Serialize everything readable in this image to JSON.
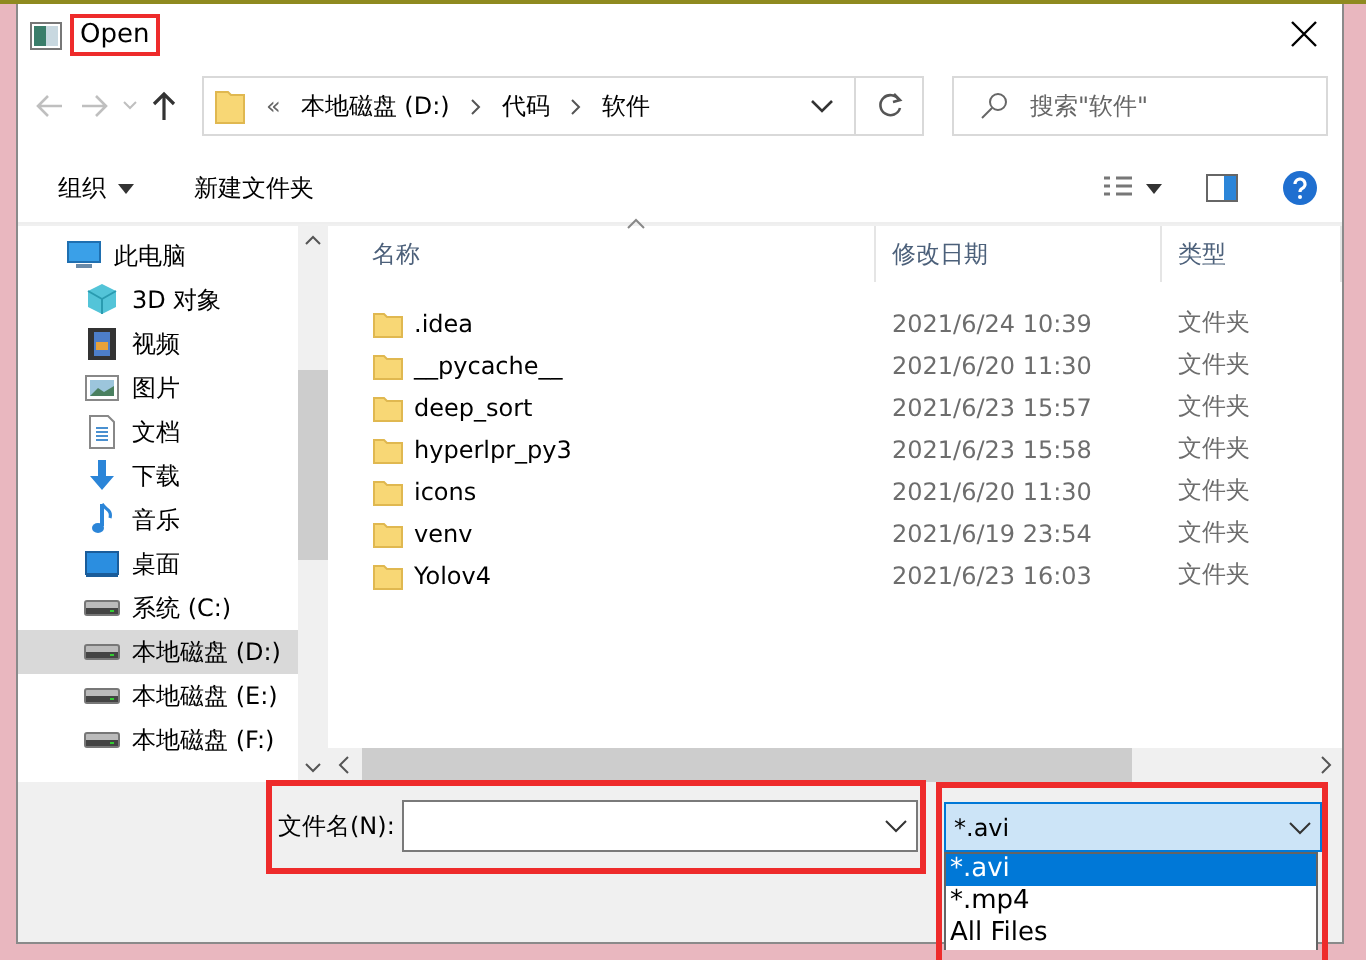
{
  "window": {
    "title": "Open"
  },
  "nav": {
    "back_disabled": true,
    "forward_disabled": true,
    "path": [
      "本地磁盘 (D:)",
      "代码",
      "软件"
    ],
    "overflow": "«",
    "search": {
      "placeholder": "搜索\"软件\""
    }
  },
  "toolbar": {
    "organize": "组织",
    "new_folder": "新建文件夹"
  },
  "sidebar": {
    "items": [
      {
        "label": "此电脑",
        "kind": "pc",
        "selected": false,
        "children": [
          {
            "label": "3D 对象",
            "kind": "objects",
            "selected": false
          },
          {
            "label": "视频",
            "kind": "video",
            "selected": false
          },
          {
            "label": "图片",
            "kind": "pictures",
            "selected": false
          },
          {
            "label": "文档",
            "kind": "documents",
            "selected": false
          },
          {
            "label": "下载",
            "kind": "downloads",
            "selected": false
          },
          {
            "label": "音乐",
            "kind": "music",
            "selected": false
          },
          {
            "label": "桌面",
            "kind": "desktop",
            "selected": false
          },
          {
            "label": "系统 (C:)",
            "kind": "drive",
            "selected": false
          },
          {
            "label": "本地磁盘 (D:)",
            "kind": "drive",
            "selected": true
          },
          {
            "label": "本地磁盘 (E:)",
            "kind": "drive",
            "selected": false
          },
          {
            "label": "本地磁盘 (F:)",
            "kind": "drive",
            "selected": false
          }
        ]
      }
    ]
  },
  "files": {
    "columns": [
      {
        "label": "名称",
        "sorted": true
      },
      {
        "label": "修改日期",
        "sorted": false
      },
      {
        "label": "类型",
        "sorted": false
      }
    ],
    "rows": [
      {
        "name": ".idea",
        "modified": "2021/6/24 10:39",
        "type": "文件夹"
      },
      {
        "name": "__pycache__",
        "modified": "2021/6/20 11:30",
        "type": "文件夹"
      },
      {
        "name": "deep_sort",
        "modified": "2021/6/23 15:57",
        "type": "文件夹"
      },
      {
        "name": "hyperlpr_py3",
        "modified": "2021/6/23 15:58",
        "type": "文件夹"
      },
      {
        "name": "icons",
        "modified": "2021/6/20 11:30",
        "type": "文件夹"
      },
      {
        "name": "venv",
        "modified": "2021/6/19 23:54",
        "type": "文件夹"
      },
      {
        "name": "Yolov4",
        "modified": "2021/6/23 16:03",
        "type": "文件夹"
      }
    ]
  },
  "footer": {
    "filename_label": "文件名(N):",
    "filetype": {
      "value": "*.avi",
      "expanded": true,
      "options": [
        {
          "label": "*.avi",
          "selected": true
        },
        {
          "label": "*.mp4",
          "selected": false
        },
        {
          "label": "All Files",
          "selected": false
        }
      ]
    }
  }
}
